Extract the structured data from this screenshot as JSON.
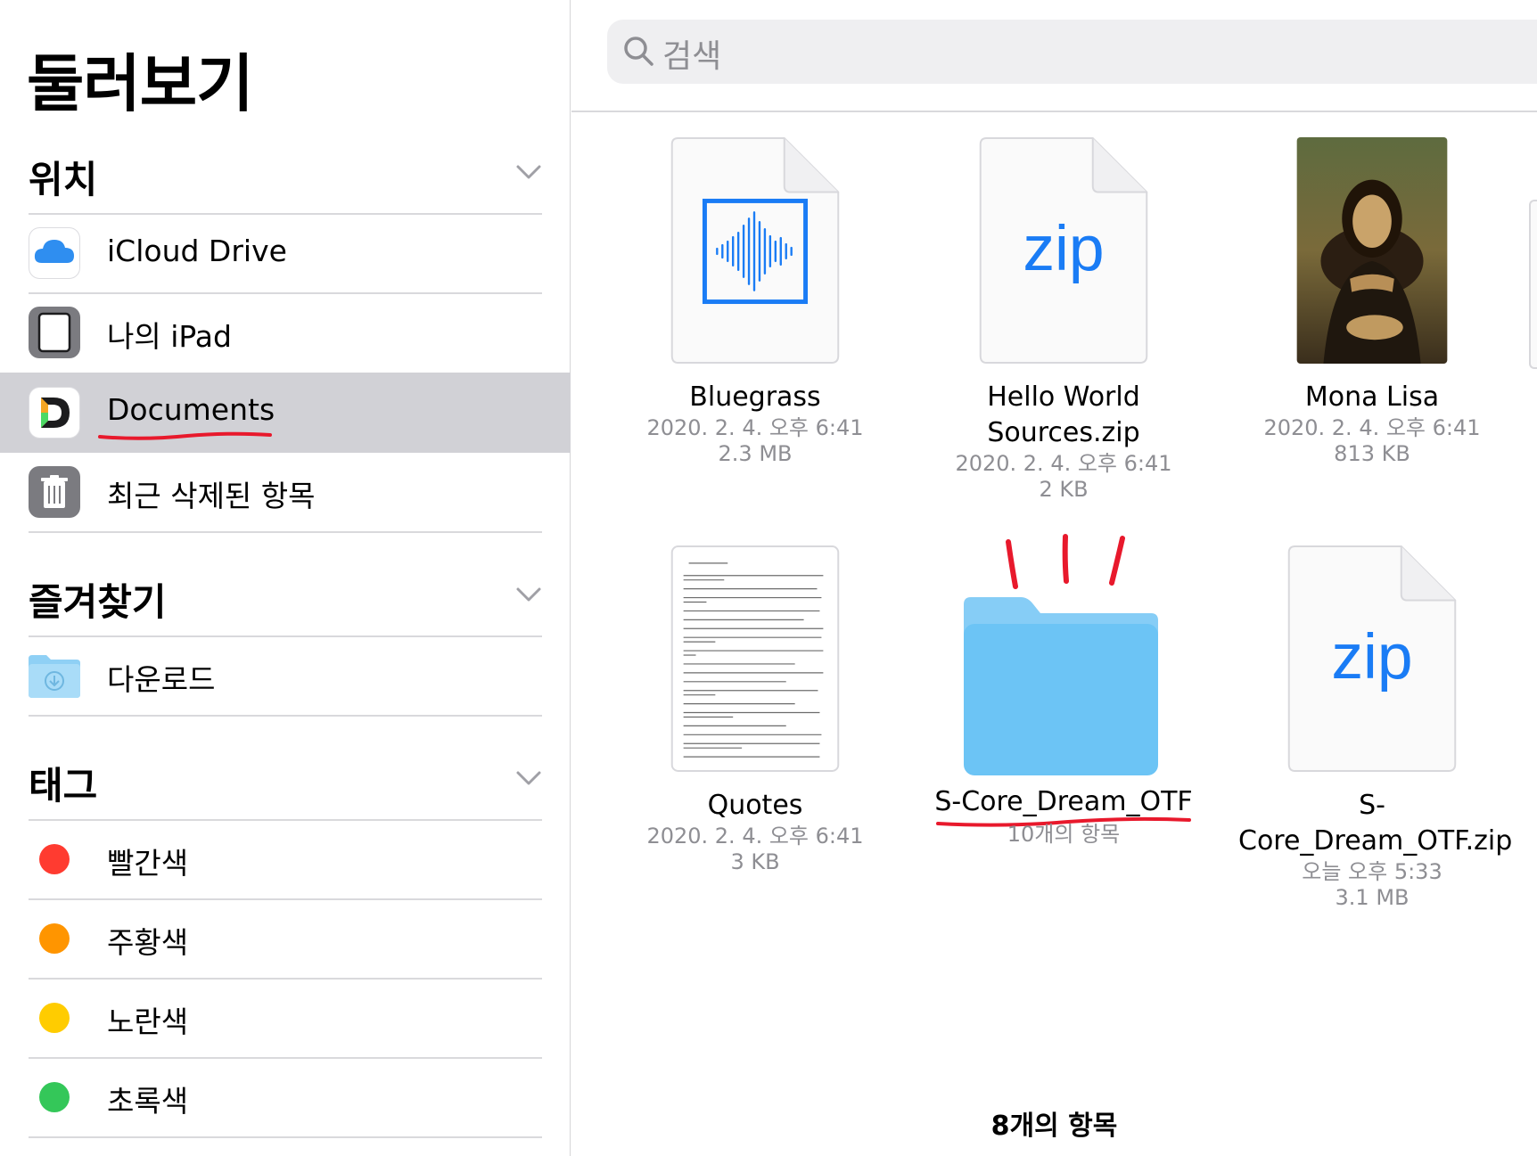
{
  "sidebar": {
    "title": "둘러보기",
    "sections": {
      "locations": {
        "title": "위치",
        "items": [
          "iCloud Drive",
          "나의 iPad",
          "Documents",
          "최근 삭제된 항목"
        ]
      },
      "favorites": {
        "title": "즐겨찾기",
        "items": [
          "다운로드"
        ]
      },
      "tags": {
        "title": "태그",
        "items": [
          "빨간색",
          "주황색",
          "노란색",
          "초록색"
        ],
        "colors": [
          "#ff3b30",
          "#ff9500",
          "#ffcc00",
          "#34c759"
        ]
      }
    },
    "selected": "Documents"
  },
  "search": {
    "placeholder": "검색"
  },
  "files": [
    {
      "name": "Bluegrass",
      "date": "2020. 2. 4. 오후 6:41",
      "size": "2.3 MB",
      "icon": "audio-file-icon"
    },
    {
      "name": "Hello World Sources.zip",
      "date": "2020. 2. 4. 오후 6:41",
      "size": "2 KB",
      "icon": "zip-file-icon",
      "glyph": "zip"
    },
    {
      "name": "Mona Lisa",
      "date": "2020. 2. 4. 오후 6:41",
      "size": "813 KB",
      "icon": "image-thumbnail"
    },
    {
      "name": "Quotes",
      "date": "2020. 2. 4. 오후 6:41",
      "size": "3 KB",
      "icon": "text-document-icon"
    },
    {
      "name": "S-Core_Dream_OTF",
      "count": "10개의 항목",
      "icon": "folder-icon"
    },
    {
      "name": "S-Core_Dream_OTF.zip",
      "date": "오늘 오후 5:33",
      "size": "3.1 MB",
      "icon": "zip-file-icon",
      "glyph": "zip"
    }
  ],
  "footer": {
    "item_count": "8개의 항목"
  },
  "colors": {
    "accent": "#1a7cf5",
    "annotation_red": "#e8192c",
    "folder_blue": "#6cc4f5"
  }
}
